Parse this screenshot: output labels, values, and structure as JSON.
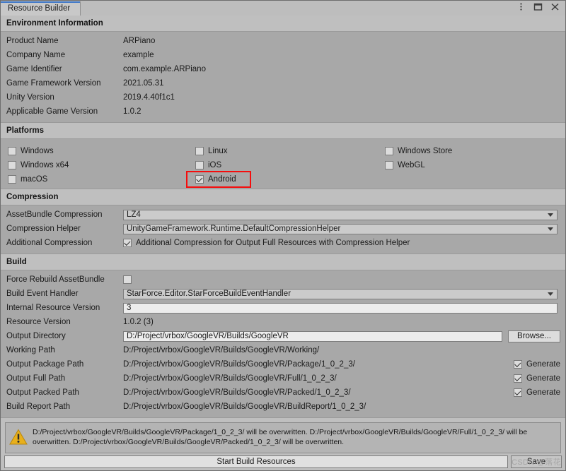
{
  "window": {
    "tab_title": "Resource Builder",
    "controls": [
      {
        "name": "more-menu",
        "glyph": "kebab"
      },
      {
        "name": "maximize",
        "glyph": "square"
      },
      {
        "name": "close",
        "glyph": "x"
      }
    ]
  },
  "environment": {
    "title": "Environment Information",
    "rows": [
      {
        "label": "Product Name",
        "value": "ARPiano"
      },
      {
        "label": "Company Name",
        "value": "example"
      },
      {
        "label": "Game Identifier",
        "value": "com.example.ARPiano"
      },
      {
        "label": "Game Framework Version",
        "value": "2021.05.31"
      },
      {
        "label": "Unity Version",
        "value": "2019.4.40f1c1"
      },
      {
        "label": "Applicable Game Version",
        "value": "1.0.2"
      }
    ]
  },
  "platforms": {
    "title": "Platforms",
    "highlight_color": "#f50d0d",
    "items": [
      {
        "label": "Windows",
        "checked": false,
        "col": 0,
        "row": 0
      },
      {
        "label": "Windows x64",
        "checked": false,
        "col": 0,
        "row": 1
      },
      {
        "label": "macOS",
        "checked": false,
        "col": 0,
        "row": 2
      },
      {
        "label": "Linux",
        "checked": false,
        "col": 1,
        "row": 0
      },
      {
        "label": "iOS",
        "checked": false,
        "col": 1,
        "row": 1
      },
      {
        "label": "Android",
        "checked": true,
        "col": 1,
        "row": 2,
        "highlighted": true
      },
      {
        "label": "Windows Store",
        "checked": false,
        "col": 2,
        "row": 0
      },
      {
        "label": "WebGL",
        "checked": false,
        "col": 2,
        "row": 1
      }
    ]
  },
  "compression": {
    "title": "Compression",
    "assetbundle_label": "AssetBundle Compression",
    "assetbundle_value": "LZ4",
    "helper_label": "Compression Helper",
    "helper_value": "UnityGameFramework.Runtime.DefaultCompressionHelper",
    "additional_label": "Additional Compression",
    "additional_checked": true,
    "additional_text": "Additional Compression for Output Full Resources with Compression Helper"
  },
  "build": {
    "title": "Build",
    "force_rebuild_label": "Force Rebuild AssetBundle",
    "force_rebuild_checked": false,
    "event_handler_label": "Build Event Handler",
    "event_handler_value": "StarForce.Editor.StarForceBuildEventHandler",
    "internal_version_label": "Internal Resource Version",
    "internal_version_value": "3",
    "resource_version_label": "Resource Version",
    "resource_version_value": "1.0.2 (3)",
    "output_directory_label": "Output Directory",
    "output_directory_value": "D:/Project/vrbox/GoogleVR/Builds/GoogleVR",
    "browse_label": "Browse...",
    "generate_label": "Generate",
    "paths": [
      {
        "label": "Working Path",
        "value": "D:/Project/vrbox/GoogleVR/Builds/GoogleVR/Working/",
        "generate": null
      },
      {
        "label": "Output Package Path",
        "value": "D:/Project/vrbox/GoogleVR/Builds/GoogleVR/Package/1_0_2_3/",
        "generate": true
      },
      {
        "label": "Output Full Path",
        "value": "D:/Project/vrbox/GoogleVR/Builds/GoogleVR/Full/1_0_2_3/",
        "generate": true
      },
      {
        "label": "Output Packed Path",
        "value": "D:/Project/vrbox/GoogleVR/Builds/GoogleVR/Packed/1_0_2_3/",
        "generate": true
      },
      {
        "label": "Build Report Path",
        "value": "D:/Project/vrbox/GoogleVR/Builds/GoogleVR/BuildReport/1_0_2_3/",
        "generate": null
      }
    ]
  },
  "warning": {
    "icon": "warning-triangle-icon",
    "color": "#e0ad20",
    "text": "D:/Project/vrbox/GoogleVR/Builds/GoogleVR/Package/1_0_2_3/ will be overwritten. D:/Project/vrbox/GoogleVR/Builds/GoogleVR/Full/1_0_2_3/ will be overwritten. D:/Project/vrbox/GoogleVR/Builds/GoogleVR/Packed/1_0_2_3/ will be overwritten."
  },
  "footer": {
    "start_build_label": "Start Build Resources",
    "save_label": "Save",
    "watermark": "CSDN @落花"
  }
}
